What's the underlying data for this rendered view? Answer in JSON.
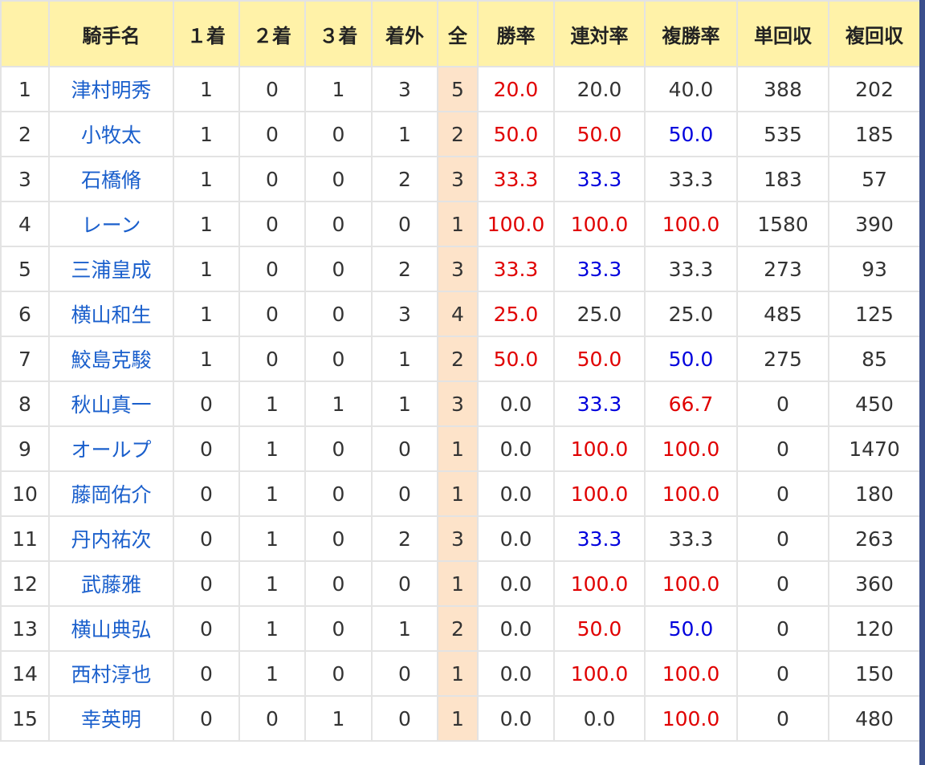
{
  "headers": [
    "",
    "騎手名",
    "１着",
    "２着",
    "３着",
    "着外",
    "全",
    "勝率",
    "連対率",
    "複勝率",
    "単回収",
    "複回収"
  ],
  "rows": [
    {
      "no": "1",
      "name": "津村明秀",
      "c1": "1",
      "c2": "0",
      "c3": "1",
      "out": "3",
      "all": "5",
      "win": "20.0",
      "win_c": "red",
      "place": "20.0",
      "place_c": "black",
      "show": "40.0",
      "show_c": "black",
      "tan": "388",
      "fuku": "202"
    },
    {
      "no": "2",
      "name": "小牧太",
      "c1": "1",
      "c2": "0",
      "c3": "0",
      "out": "1",
      "all": "2",
      "win": "50.0",
      "win_c": "red",
      "place": "50.0",
      "place_c": "red",
      "show": "50.0",
      "show_c": "blue",
      "tan": "535",
      "fuku": "185"
    },
    {
      "no": "3",
      "name": "石橋脩",
      "c1": "1",
      "c2": "0",
      "c3": "0",
      "out": "2",
      "all": "3",
      "win": "33.3",
      "win_c": "red",
      "place": "33.3",
      "place_c": "blue",
      "show": "33.3",
      "show_c": "black",
      "tan": "183",
      "fuku": "57"
    },
    {
      "no": "4",
      "name": "レーン",
      "c1": "1",
      "c2": "0",
      "c3": "0",
      "out": "0",
      "all": "1",
      "win": "100.0",
      "win_c": "red",
      "place": "100.0",
      "place_c": "red",
      "show": "100.0",
      "show_c": "red",
      "tan": "1580",
      "fuku": "390"
    },
    {
      "no": "5",
      "name": "三浦皇成",
      "c1": "1",
      "c2": "0",
      "c3": "0",
      "out": "2",
      "all": "3",
      "win": "33.3",
      "win_c": "red",
      "place": "33.3",
      "place_c": "blue",
      "show": "33.3",
      "show_c": "black",
      "tan": "273",
      "fuku": "93"
    },
    {
      "no": "6",
      "name": "横山和生",
      "c1": "1",
      "c2": "0",
      "c3": "0",
      "out": "3",
      "all": "4",
      "win": "25.0",
      "win_c": "red",
      "place": "25.0",
      "place_c": "black",
      "show": "25.0",
      "show_c": "black",
      "tan": "485",
      "fuku": "125"
    },
    {
      "no": "7",
      "name": "鮫島克駿",
      "c1": "1",
      "c2": "0",
      "c3": "0",
      "out": "1",
      "all": "2",
      "win": "50.0",
      "win_c": "red",
      "place": "50.0",
      "place_c": "red",
      "show": "50.0",
      "show_c": "blue",
      "tan": "275",
      "fuku": "85"
    },
    {
      "no": "8",
      "name": "秋山真一",
      "c1": "0",
      "c2": "1",
      "c3": "1",
      "out": "1",
      "all": "3",
      "win": "0.0",
      "win_c": "black",
      "place": "33.3",
      "place_c": "blue",
      "show": "66.7",
      "show_c": "red",
      "tan": "0",
      "fuku": "450"
    },
    {
      "no": "9",
      "name": "オールプ",
      "c1": "0",
      "c2": "1",
      "c3": "0",
      "out": "0",
      "all": "1",
      "win": "0.0",
      "win_c": "black",
      "place": "100.0",
      "place_c": "red",
      "show": "100.0",
      "show_c": "red",
      "tan": "0",
      "fuku": "1470"
    },
    {
      "no": "10",
      "name": "藤岡佑介",
      "c1": "0",
      "c2": "1",
      "c3": "0",
      "out": "0",
      "all": "1",
      "win": "0.0",
      "win_c": "black",
      "place": "100.0",
      "place_c": "red",
      "show": "100.0",
      "show_c": "red",
      "tan": "0",
      "fuku": "180"
    },
    {
      "no": "11",
      "name": "丹内祐次",
      "c1": "0",
      "c2": "1",
      "c3": "0",
      "out": "2",
      "all": "3",
      "win": "0.0",
      "win_c": "black",
      "place": "33.3",
      "place_c": "blue",
      "show": "33.3",
      "show_c": "black",
      "tan": "0",
      "fuku": "263"
    },
    {
      "no": "12",
      "name": "武藤雅",
      "c1": "0",
      "c2": "1",
      "c3": "0",
      "out": "0",
      "all": "1",
      "win": "0.0",
      "win_c": "black",
      "place": "100.0",
      "place_c": "red",
      "show": "100.0",
      "show_c": "red",
      "tan": "0",
      "fuku": "360"
    },
    {
      "no": "13",
      "name": "横山典弘",
      "c1": "0",
      "c2": "1",
      "c3": "0",
      "out": "1",
      "all": "2",
      "win": "0.0",
      "win_c": "black",
      "place": "50.0",
      "place_c": "red",
      "show": "50.0",
      "show_c": "blue",
      "tan": "0",
      "fuku": "120"
    },
    {
      "no": "14",
      "name": "西村淳也",
      "c1": "0",
      "c2": "1",
      "c3": "0",
      "out": "0",
      "all": "1",
      "win": "0.0",
      "win_c": "black",
      "place": "100.0",
      "place_c": "red",
      "show": "100.0",
      "show_c": "red",
      "tan": "0",
      "fuku": "150"
    },
    {
      "no": "15",
      "name": "幸英明",
      "c1": "0",
      "c2": "0",
      "c3": "1",
      "out": "0",
      "all": "1",
      "win": "0.0",
      "win_c": "black",
      "place": "0.0",
      "place_c": "black",
      "show": "100.0",
      "show_c": "red",
      "tan": "0",
      "fuku": "480"
    }
  ],
  "colors": {
    "header_bg": "#fff2a8",
    "total_col_bg": "#fde3c9",
    "link": "#1a5fcc",
    "red": "#e00000",
    "blue": "#0000dd",
    "border": "#e3e3e3",
    "scrollbar": "#3b4f8c"
  }
}
